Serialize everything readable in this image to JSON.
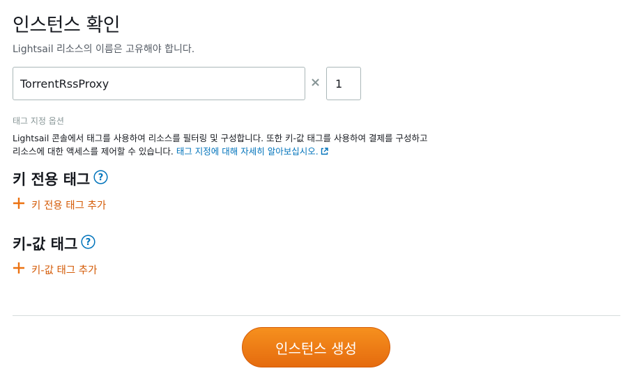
{
  "header": {
    "title": "인스턴스 확인",
    "subtitle": "Lightsail 리소스의 이름은 고유해야 합니다."
  },
  "instance": {
    "name_value": "TorrentRssProxy",
    "multiplier_symbol": "×",
    "quantity_value": "1"
  },
  "tags": {
    "options_label": "태그 지정 옵션",
    "description": "Lightsail 콘솔에서 태그를 사용하여 리소스를 필터링 및 구성합니다. 또한 키-값 태그를 사용하여 결제를 구성하고 리소스에 대한 액세스를 제어할 수 있습니다.",
    "learn_more_link": "태그 지정에 대해 자세히 알아보십시오.",
    "key_only": {
      "heading": "키 전용 태그",
      "add_label": "키 전용 태그 추가"
    },
    "key_value": {
      "heading": "키-값 태그",
      "add_label": "키-값 태그 추가"
    }
  },
  "actions": {
    "create_label": "인스턴스 생성"
  },
  "colors": {
    "accent_orange": "#ec7211",
    "link_blue": "#0073bb",
    "text_dark": "#16191f",
    "text_muted": "#545b64"
  }
}
